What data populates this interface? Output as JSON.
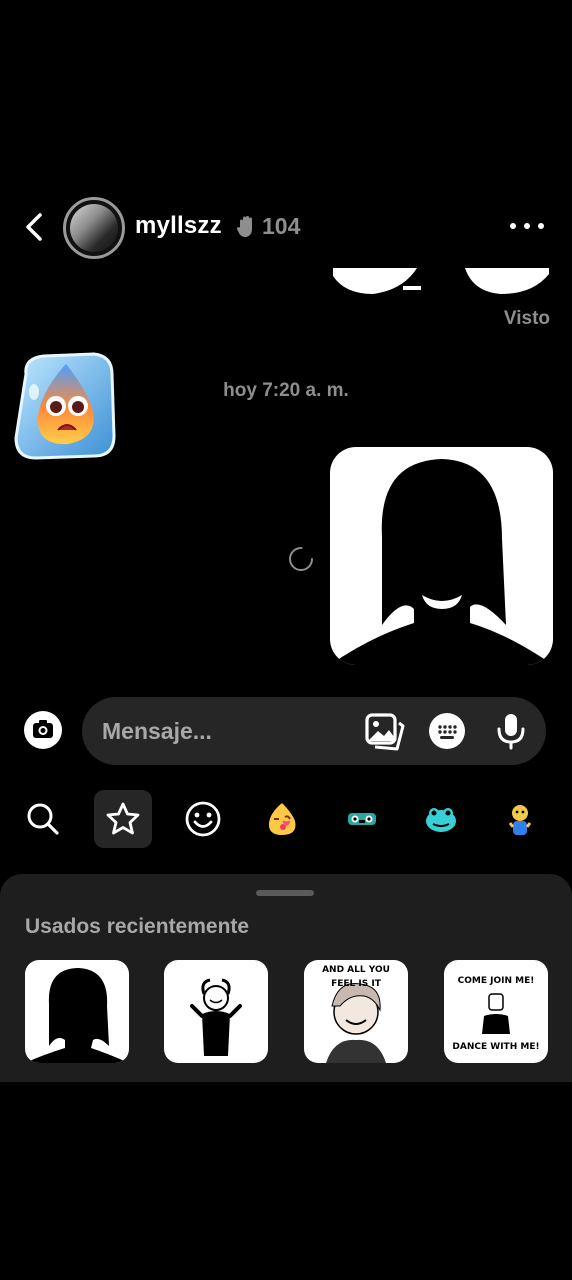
{
  "header": {
    "username": "myllszz",
    "streak_count": "104"
  },
  "chat": {
    "seen_label": "Visto",
    "timestamp": "hoy 7:20 a. m."
  },
  "composer": {
    "placeholder": "Mensaje..."
  },
  "tabs": [
    {
      "name": "search",
      "icon": "search-icon"
    },
    {
      "name": "favorites",
      "icon": "star-icon"
    },
    {
      "name": "emoji",
      "icon": "smiley-icon"
    },
    {
      "name": "pack-1",
      "icon": "kiss-face-sticker"
    },
    {
      "name": "pack-2",
      "icon": "frog-sticker"
    },
    {
      "name": "pack-3",
      "icon": "blue-frog-sticker"
    },
    {
      "name": "pack-4",
      "icon": "character-sticker"
    }
  ],
  "panel": {
    "title": "Usados recientemente",
    "recent": [
      {
        "top_text": "",
        "bottom_text": ""
      },
      {
        "top_text": "",
        "bottom_text": ""
      },
      {
        "top_text": "AND ALL YOU FEEL IS IT",
        "bottom_text": ""
      },
      {
        "top_text": "COME JOIN ME!",
        "bottom_text": "DANCE WITH ME!"
      }
    ]
  },
  "colors": {
    "background": "#000000",
    "secondary_text": "#8e8e8e",
    "input_bg": "#262626",
    "panel_bg": "#1e1e1e"
  }
}
